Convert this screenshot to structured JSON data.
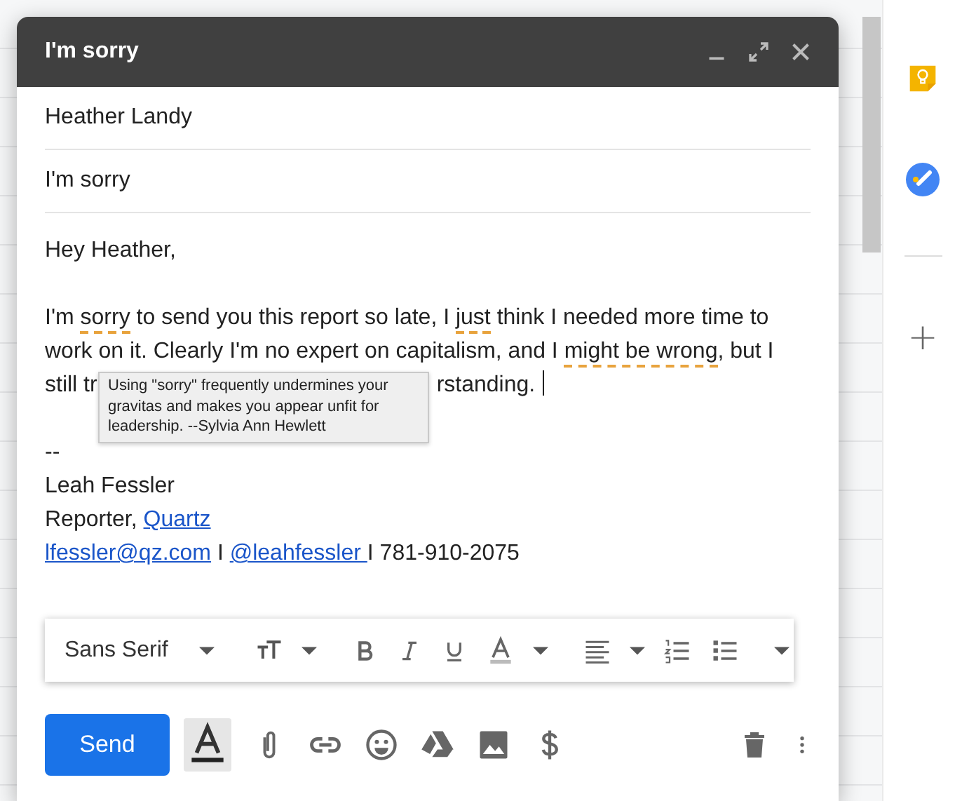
{
  "compose": {
    "title": "I'm sorry",
    "to": "Heather Landy",
    "subject": "I'm sorry",
    "greeting": "Hey Heather,",
    "body_lines": [
      [
        {
          "text": "I'm ",
          "flagged": false
        },
        {
          "text": "sorry",
          "flagged": true
        },
        {
          "text": " to send you this report so late, I ",
          "flagged": false
        },
        {
          "text": "just",
          "flagged": true
        },
        {
          "text": " think I needed more time to",
          "flagged": false
        }
      ],
      [
        {
          "text": "work on it. Clearly I'm no expert on capitalism, and I ",
          "flagged": false
        },
        {
          "text": "might be wrong",
          "flagged": true
        },
        {
          "text": ", but I",
          "flagged": false
        }
      ],
      [
        {
          "text": "still tr",
          "flagged": false
        },
        {
          "text": "rstanding.",
          "flagged": false
        }
      ]
    ],
    "tooltip": "Using \"sorry\" frequently undermines your gravitas and makes you appear unfit for leadership. --Sylvia Ann Hewlett",
    "signature": [
      [
        {
          "kind": "text",
          "text": "--"
        }
      ],
      [
        {
          "kind": "text",
          "text": "Leah Fessler"
        }
      ],
      [
        {
          "kind": "text",
          "text": "Reporter, "
        },
        {
          "kind": "link",
          "text": "Quartz"
        }
      ],
      [
        {
          "kind": "link",
          "text": "lfessler@qz.com"
        },
        {
          "kind": "text",
          "text": " I "
        },
        {
          "kind": "link",
          "text": "@leahfessler "
        },
        {
          "kind": "text",
          "text": "I 781-910-2075"
        }
      ]
    ],
    "formatting": {
      "open": true,
      "font": "Sans Serif"
    },
    "send_label": "Send"
  },
  "side_panel": {
    "add_label": "+"
  }
}
